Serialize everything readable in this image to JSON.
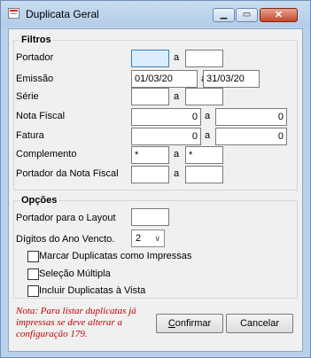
{
  "window": {
    "title": "Duplicata Geral"
  },
  "filtros": {
    "title": "Filtros",
    "range_sep": "a",
    "portador": {
      "label": "Portador",
      "from": "",
      "to": ""
    },
    "emissao": {
      "label": "Emissão",
      "from": "01/03/20",
      "to": "31/03/20"
    },
    "serie": {
      "label": "Série",
      "from": "",
      "to": ""
    },
    "nota_fiscal": {
      "label": "Nota Fiscal",
      "from": "0",
      "to": "0"
    },
    "fatura": {
      "label": "Fatura",
      "from": "0",
      "to": "0"
    },
    "complemento": {
      "label": "Complemento",
      "from": "*",
      "to": "*"
    },
    "portador_nf": {
      "label": "Portador da Nota Fiscal",
      "from": "",
      "to": ""
    }
  },
  "opcoes": {
    "title": "Opções",
    "portador_layout": {
      "label": "Portador para o Layout",
      "value": ""
    },
    "digitos_ano": {
      "label": "Dígitos do Ano Vencto.",
      "value": "2"
    },
    "marcar_impressas": {
      "label": "Marcar Duplicatas como Impressas",
      "checked": false
    },
    "selecao_multipla": {
      "label": "Seleção Múltipla",
      "checked": false
    },
    "incluir_vista": {
      "label": "Incluir Duplicatas à Vista",
      "checked": false
    }
  },
  "note": "Nota: Para listar duplicatas já impressas se deve alterar a configuração 179.",
  "buttons": {
    "confirmar": {
      "accel": "C",
      "rest": "onfirmar"
    },
    "cancelar": {
      "label": "Cancelar"
    }
  }
}
